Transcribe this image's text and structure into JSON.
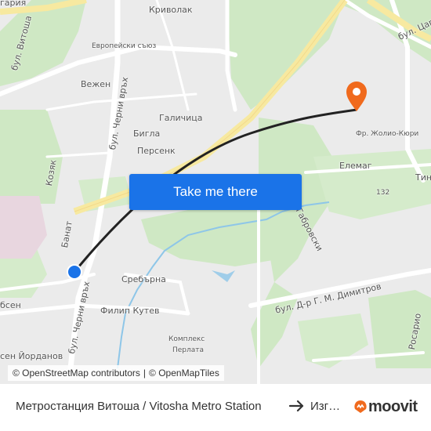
{
  "map": {
    "street_labels": {
      "krivolak": "Криволак",
      "evropeyski_sayuz": "Европейски съюз",
      "vezhen": "Вежен",
      "cherni_vrah_top": "бул. Черни връх",
      "galichitsa": "Галичица",
      "bigla": "Бигла",
      "persenk": "Персенк",
      "kozyak": "Козяк",
      "banat": "Банат",
      "srebarna": "Сребърна",
      "filip_kutev": "Филип Кутев",
      "cherni_vrah_bottom": "бул. Черни връх",
      "kompleks_perlata_1": "Комплекс",
      "kompleks_perlata_2": "Перлата",
      "yordanov": "сен Йорданов",
      "besen": "бсен",
      "elemag": "Елемаг",
      "joliot_curie": "Фр. Жолио-Кюри",
      "tin": "Тин",
      "n132": "132",
      "gabrovski": "ла Габровски",
      "dimitrov": "бул. Д-р Г. М. Димитров",
      "rosario": "Росарио",
      "tsaritsa": "бул. Цари",
      "vitosha": "бул. Витоша",
      "bulgaria": "гария"
    },
    "origin_marker": "origin-dot",
    "destination_marker": "map-pin",
    "accent_color": "#1a73e8",
    "route_color": "#222222",
    "pin_color": "#f06a1d"
  },
  "cta": {
    "label": "Take me there"
  },
  "attribution": {
    "osm": "© OpenStreetMap contributors",
    "separator": "|",
    "omt": "© OpenMapTiles"
  },
  "footer": {
    "origin": "Метростанция Витоша / Vitosha Metro Station",
    "destination": "Изгрев",
    "brand": "moovit"
  }
}
